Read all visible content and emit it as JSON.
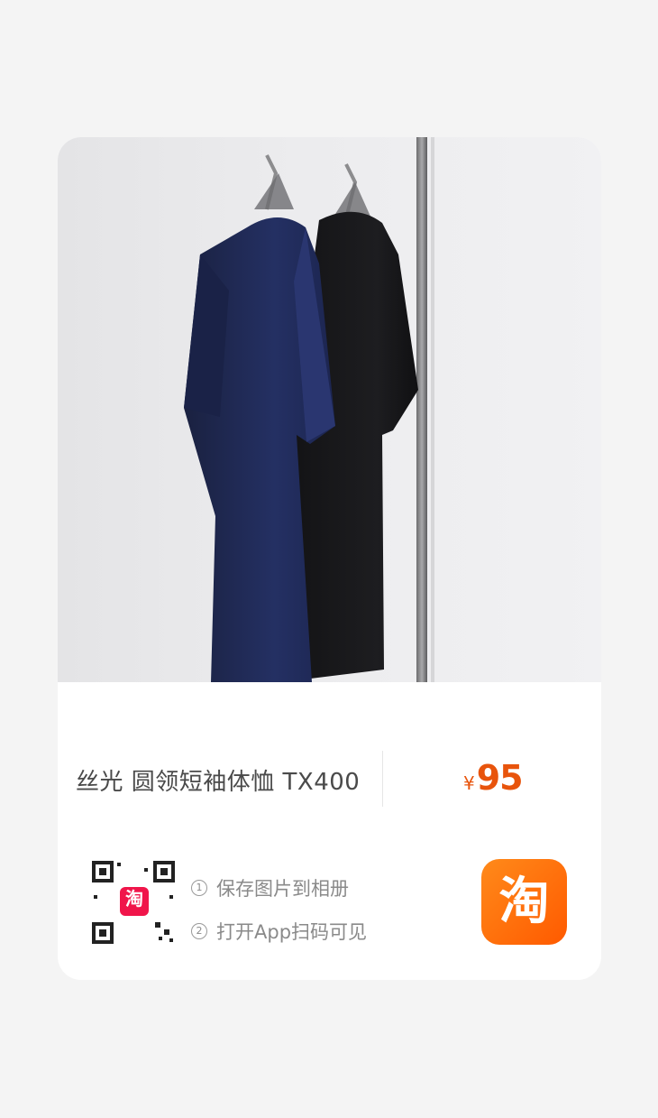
{
  "product": {
    "title": "丝光 圆领短袖体恤 TX400",
    "price_symbol": "¥",
    "price": "95",
    "image": "navy-and-black-tshirts-on-rack"
  },
  "share": {
    "step1_num": "1",
    "step1_text": "保存图片到相册",
    "step2_num": "2",
    "step2_text": "打开App扫码可见",
    "qr_badge": "淘",
    "logo_char": "淘"
  },
  "colors": {
    "price": "#e8540c",
    "logo": "#ff6a00",
    "background": "#f4f4f4"
  }
}
